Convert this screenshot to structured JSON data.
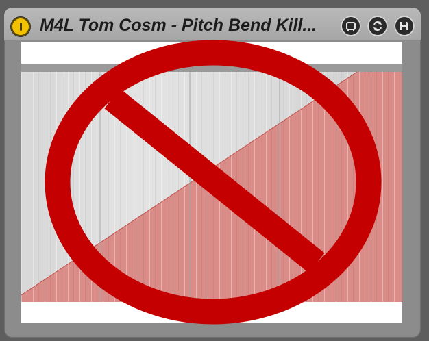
{
  "device": {
    "title": "M4L Tom Cosm - Pitch Bend Kill...",
    "buttons": {
      "power": "power-icon",
      "map": "device-map-icon",
      "hot_swap": "hot-swap-icon",
      "save": "save-icon"
    }
  },
  "overlay": {
    "symbol": "prohibition-sign",
    "color": "#c40000"
  },
  "colors": {
    "titlebar": "#b3b3b3",
    "power_accent": "#f2c200",
    "graph_fill": "#d98c88"
  }
}
